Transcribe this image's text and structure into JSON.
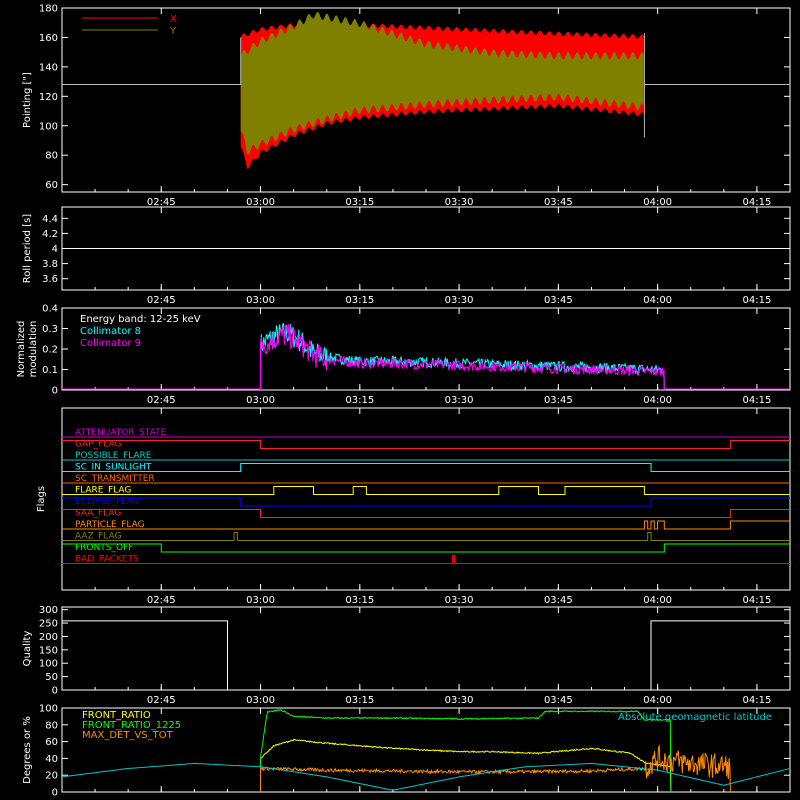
{
  "time_ticks": [
    "02:45",
    "03:00",
    "03:15",
    "03:30",
    "03:45",
    "04:00",
    "04:15"
  ],
  "x_range_minutes": [
    150,
    230
  ],
  "tick_minutes": [
    165,
    180,
    195,
    210,
    225,
    240,
    255
  ],
  "colors": {
    "x_series": "#ff0000",
    "y_series": "#808000",
    "collimator8": "#00ffff",
    "collimator9": "#ff00ff",
    "front_ratio": "#ffff00",
    "front_ratio_1225": "#00ff00",
    "max_det": "#ff8c00",
    "geomag": "#00c8c8"
  },
  "chart_data": [
    {
      "type": "area",
      "ylabel": "Pointing [\"]",
      "ylim": [
        55,
        180
      ],
      "yticks": [
        60,
        80,
        100,
        120,
        140,
        160,
        180
      ],
      "legend": "top-left",
      "reference_line": 128,
      "data_time_range": [
        "02:57",
        "03:59"
      ],
      "series": [
        {
          "name": "X",
          "color": "#ff0000",
          "envelope_upper": [
            [
              177,
              162
            ],
            [
              180,
              167
            ],
            [
              185,
              170
            ],
            [
              190,
              172
            ],
            [
              195,
              170
            ],
            [
              205,
              168
            ],
            [
              215,
              166
            ],
            [
              225,
              164
            ],
            [
              238,
              162
            ]
          ],
          "envelope_lower": [
            [
              177,
              85
            ],
            [
              178,
              70
            ],
            [
              180,
              80
            ],
            [
              185,
              92
            ],
            [
              190,
              100
            ],
            [
              195,
              104
            ],
            [
              205,
              108
            ],
            [
              215,
              110
            ],
            [
              225,
              112
            ],
            [
              238,
              106
            ]
          ]
        },
        {
          "name": "Y",
          "color": "#808000",
          "envelope_upper": [
            [
              177,
              150
            ],
            [
              180,
              160
            ],
            [
              185,
              170
            ],
            [
              188,
              178
            ],
            [
              195,
              172
            ],
            [
              205,
              158
            ],
            [
              215,
              152
            ],
            [
              225,
              150
            ],
            [
              238,
              150
            ]
          ],
          "envelope_lower": [
            [
              177,
              95
            ],
            [
              178,
              80
            ],
            [
              180,
              85
            ],
            [
              185,
              95
            ],
            [
              190,
              102
            ],
            [
              195,
              108
            ],
            [
              205,
              112
            ],
            [
              215,
              115
            ],
            [
              225,
              117
            ],
            [
              238,
              110
            ]
          ]
        }
      ]
    },
    {
      "type": "line",
      "ylabel": "Roll period [s]",
      "ylim": [
        3.45,
        4.55
      ],
      "yticks": [
        3.6,
        3.8,
        4.0,
        4.2,
        4.4
      ],
      "series": [
        {
          "name": "",
          "constant": 4.0,
          "color": "#ffffff"
        }
      ]
    },
    {
      "type": "line",
      "ylabel": "Normalized modulation",
      "ylim": [
        0,
        0.4
      ],
      "yticks": [
        0.0,
        0.1,
        0.2,
        0.3,
        0.4
      ],
      "annotation": "Energy band: 12-25 keV",
      "legend": "top-left",
      "series": [
        {
          "name": "Collimator 8",
          "color": "#00ffff",
          "x": [
            180,
            182,
            184,
            186,
            188,
            190,
            195,
            200,
            210,
            220,
            230,
            240,
            241
          ],
          "y": [
            0.22,
            0.26,
            0.28,
            0.24,
            0.18,
            0.16,
            0.14,
            0.14,
            0.13,
            0.12,
            0.11,
            0.1,
            0.1
          ]
        },
        {
          "name": "Collimator 9",
          "color": "#ff00ff",
          "x": [
            180,
            182,
            184,
            186,
            188,
            190,
            195,
            200,
            210,
            220,
            230,
            240,
            241
          ],
          "y": [
            0.21,
            0.25,
            0.27,
            0.23,
            0.17,
            0.15,
            0.13,
            0.13,
            0.12,
            0.11,
            0.1,
            0.09,
            0.09
          ]
        }
      ]
    },
    {
      "type": "line",
      "ylabel": "Flags",
      "flags": [
        {
          "name": "ATTENUATOR_STATE",
          "color": "#cc00cc",
          "segments": [
            [
              150,
              260,
              0
            ]
          ]
        },
        {
          "name": "GAP_FLAG",
          "color": "#ff2020",
          "segments": [
            [
              150,
              180,
              1
            ],
            [
              180,
              251,
              0
            ],
            [
              251,
              260,
              1
            ]
          ]
        },
        {
          "name": "POSSIBLE_FLARE",
          "color": "#00cccc",
          "segments": [
            [
              150,
              260,
              0
            ]
          ]
        },
        {
          "name": "SC_IN_SUNLIGHT",
          "color": "#00ffff",
          "segments": [
            [
              150,
              177,
              0
            ],
            [
              177,
              239,
              1
            ],
            [
              239,
              260,
              0
            ]
          ]
        },
        {
          "name": "SC_TRANSMITTER",
          "color": "#ff6600",
          "segments": [
            [
              150,
              260,
              0
            ]
          ]
        },
        {
          "name": "FLARE_FLAG",
          "color": "#ffff00",
          "segments": [
            [
              150,
              182,
              0
            ],
            [
              182,
              188,
              1
            ],
            [
              188,
              194,
              0
            ],
            [
              194,
              196,
              1
            ],
            [
              196,
              216,
              0
            ],
            [
              216,
              222,
              1
            ],
            [
              222,
              226,
              0
            ],
            [
              226,
              238,
              1
            ],
            [
              238,
              260,
              0
            ]
          ]
        },
        {
          "name": "ECLIPSE_FLAG",
          "color": "#0000ff",
          "segments": [
            [
              150,
              177,
              1
            ],
            [
              177,
              239,
              0
            ],
            [
              239,
              260,
              1
            ]
          ]
        },
        {
          "name": "SAA_FLAG",
          "color": "#ff2020",
          "segments": [
            [
              150,
              180,
              1
            ],
            [
              180,
              251,
              0
            ],
            [
              251,
              260,
              1
            ]
          ]
        },
        {
          "name": "PARTICLE_FLAG",
          "color": "#ff8c00",
          "segments": [
            [
              150,
              238,
              0
            ],
            [
              238,
              238.5,
              1
            ],
            [
              238.5,
              239,
              0
            ],
            [
              239,
              239.5,
              1
            ],
            [
              239.5,
              240,
              0
            ],
            [
              240,
              241,
              1
            ],
            [
              241,
              242,
              0
            ],
            [
              242,
              250,
              0
            ],
            [
              250,
              251,
              0
            ],
            [
              251,
              260,
              1
            ]
          ]
        },
        {
          "name": "AAZ_FLAG",
          "color": "#808000",
          "segments": [
            [
              150,
              176,
              0
            ],
            [
              176,
              176.5,
              1
            ],
            [
              176.5,
              238.5,
              0
            ],
            [
              238.5,
              239,
              1
            ],
            [
              239,
              260,
              0
            ]
          ]
        },
        {
          "name": "FRONTS_OFF",
          "color": "#00ff00",
          "segments": [
            [
              150,
              165,
              1
            ],
            [
              165,
              241,
              0
            ],
            [
              241,
              260,
              1
            ]
          ]
        },
        {
          "name": "BAD_PACKETS",
          "color": "#ff0000",
          "segments": [
            [
              150,
              209,
              0
            ],
            [
              209,
              209.3,
              1
            ],
            [
              209.3,
              260,
              0
            ]
          ]
        }
      ]
    },
    {
      "type": "line",
      "ylabel": "Quality",
      "ylim": [
        0,
        310
      ],
      "yticks": [
        0,
        50,
        100,
        150,
        200,
        250,
        300
      ],
      "series": [
        {
          "name": "",
          "color": "#ffffff",
          "x": [
            150,
            175,
            175,
            239,
            239,
            260
          ],
          "y": [
            258,
            258,
            0,
            0,
            258,
            258
          ]
        }
      ]
    },
    {
      "type": "line",
      "ylabel": "Degrees or %",
      "ylim": [
        0,
        100
      ],
      "yticks": [
        0,
        20,
        40,
        60,
        80,
        100
      ],
      "legend": "top-left",
      "series": [
        {
          "name": "FRONT_RATIO",
          "color": "#ffff00",
          "x": [
            180,
            182,
            185,
            190,
            200,
            210,
            215,
            222,
            230,
            236,
            238,
            242
          ],
          "y": [
            40,
            55,
            62,
            58,
            52,
            48,
            48,
            46,
            52,
            46,
            35,
            30
          ]
        },
        {
          "name": "FRONT_RATIO_1225",
          "color": "#00ff00",
          "x": [
            180,
            181,
            183,
            185,
            190,
            200,
            210,
            222,
            223,
            237,
            238,
            242
          ],
          "y": [
            40,
            95,
            98,
            90,
            88,
            88,
            87,
            88,
            96,
            96,
            86,
            86
          ]
        },
        {
          "name": "MAX_DET_VS_TOT",
          "color": "#ff8c00",
          "x": [
            180,
            190,
            200,
            210,
            220,
            230,
            238,
            240,
            244,
            248,
            251
          ],
          "y": [
            28,
            26,
            25,
            24,
            24,
            25,
            28,
            40,
            35,
            32,
            30
          ]
        },
        {
          "name": "Absolute geomagnetic latitude",
          "color": "#00c8c8",
          "x": [
            150,
            160,
            170,
            180,
            190,
            200,
            210,
            220,
            230,
            240,
            250,
            260
          ],
          "y": [
            18,
            28,
            34,
            30,
            18,
            2,
            18,
            30,
            34,
            26,
            8,
            28
          ]
        }
      ]
    }
  ]
}
